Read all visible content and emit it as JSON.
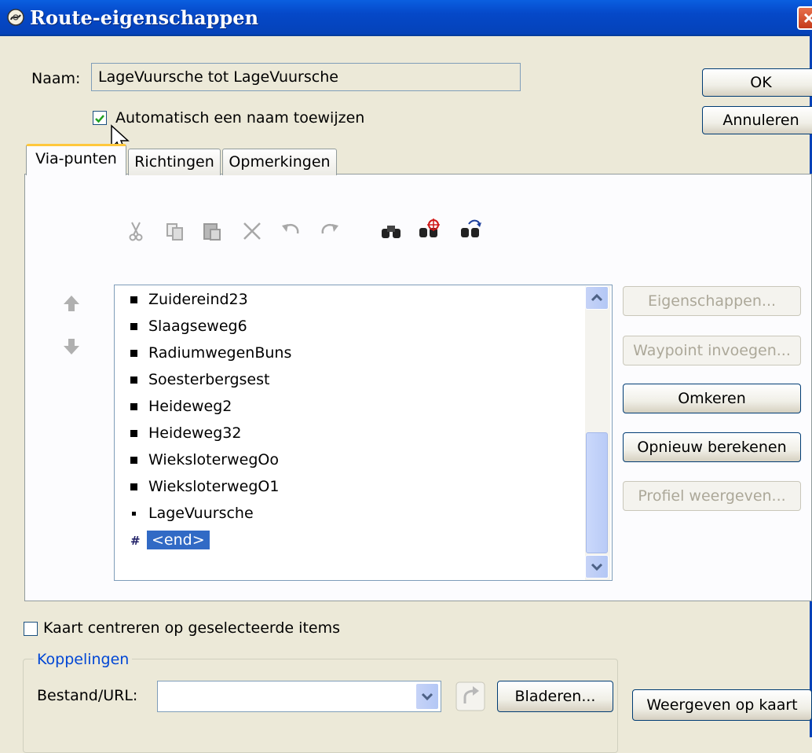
{
  "window": {
    "title": "Route-eigenschappen"
  },
  "name_field": {
    "label": "Naam:",
    "value": "LageVuursche tot LageVuursche"
  },
  "auto_name": {
    "label": "Automatisch een naam toewijzen",
    "checked": true
  },
  "buttons": {
    "ok": "OK",
    "cancel": "Annuleren"
  },
  "tabs": [
    {
      "label": "Via-punten",
      "active": true
    },
    {
      "label": "Richtingen",
      "active": false
    },
    {
      "label": "Opmerkingen",
      "active": false
    }
  ],
  "toolbar": {
    "icons": [
      "cut-icon",
      "copy-icon",
      "paste-icon",
      "delete-icon",
      "undo-icon",
      "redo-icon",
      "find-icon",
      "find-target-icon",
      "find-next-icon"
    ]
  },
  "waypoints": [
    {
      "label": "Zuidereind23",
      "marker": "square",
      "selected": false
    },
    {
      "label": "Slaagseweg6",
      "marker": "square",
      "selected": false
    },
    {
      "label": "RadiumwegenBuns",
      "marker": "square",
      "selected": false
    },
    {
      "label": "Soesterbergsest",
      "marker": "square",
      "selected": false
    },
    {
      "label": "Heideweg2",
      "marker": "square",
      "selected": false
    },
    {
      "label": "Heideweg32",
      "marker": "square",
      "selected": false
    },
    {
      "label": "WieksloterwegOo",
      "marker": "square",
      "selected": false
    },
    {
      "label": "WieksloterwegO1",
      "marker": "square",
      "selected": false
    },
    {
      "label": "LageVuursche",
      "marker": "dot",
      "selected": false
    },
    {
      "label": "<end>",
      "marker": "hash",
      "selected": true
    }
  ],
  "side_buttons": {
    "properties": "Eigenschappen...",
    "insert_waypoint": "Waypoint invoegen...",
    "reverse": "Omkeren",
    "recalculate": "Opnieuw berekenen",
    "profile": "Profiel weergeven..."
  },
  "center_map": {
    "label": "Kaart centreren op geselecteerde items",
    "checked": false
  },
  "links": {
    "group_label": "Koppelingen",
    "file_label": "Bestand/URL:",
    "file_value": "",
    "browse": "Bladeren...",
    "show_on_map": "Weergeven op kaart"
  },
  "colors": {
    "selection": "#316ac5",
    "titlebar": "#0548c8"
  }
}
